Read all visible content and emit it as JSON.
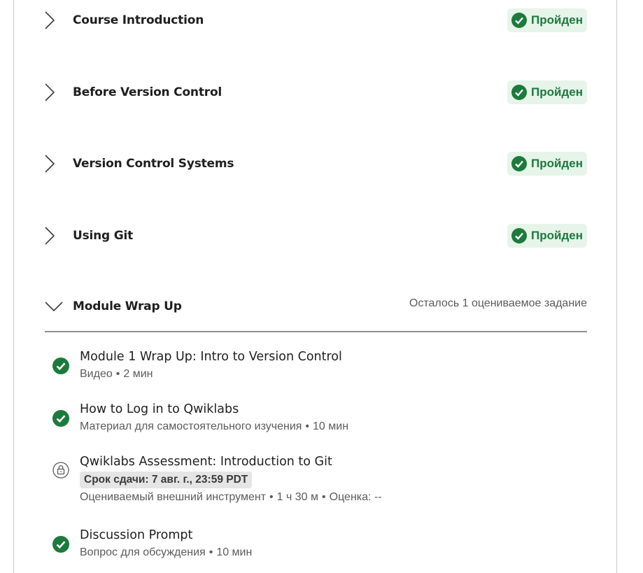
{
  "lessons": [
    {
      "title": "Course Introduction",
      "status": "Пройден"
    },
    {
      "title": "Before Version Control",
      "status": "Пройден"
    },
    {
      "title": "Version Control Systems",
      "status": "Пройден"
    },
    {
      "title": "Using Git",
      "status": "Пройден"
    }
  ],
  "module": {
    "title": "Module Wrap Up",
    "remaining": "Осталось 1 оцениваемое задание"
  },
  "items": [
    {
      "title": "Module 1 Wrap Up: Intro to Version Control",
      "type": "Видео",
      "duration": "2 мин",
      "icon": "check-circle-icon"
    },
    {
      "title": "How to Log in to Qwiklabs",
      "type": "Материал для самостоятельного изучения",
      "duration": "10 мин",
      "icon": "check-circle-icon"
    },
    {
      "title": "Qwiklabs Assessment: Introduction to Git",
      "deadline": "Срок сдачи: 7 авг. г., 23:59 PDT",
      "type": "Оцениваемый внешний инструмент",
      "duration": "1 ч 30 м",
      "grade": "Оценка: --",
      "icon": "lock-icon"
    },
    {
      "title": "Discussion Prompt",
      "type": "Вопрос для обсуждения",
      "duration": "10 мин",
      "icon": "check-circle-icon"
    }
  ],
  "separator": "•",
  "colors": {
    "success": "#1c7a3c",
    "success_bg": "#e6f4ea",
    "text": "#1f1f1f",
    "muted": "#5b5b5b",
    "deadline_bg": "#e5e5e5"
  }
}
